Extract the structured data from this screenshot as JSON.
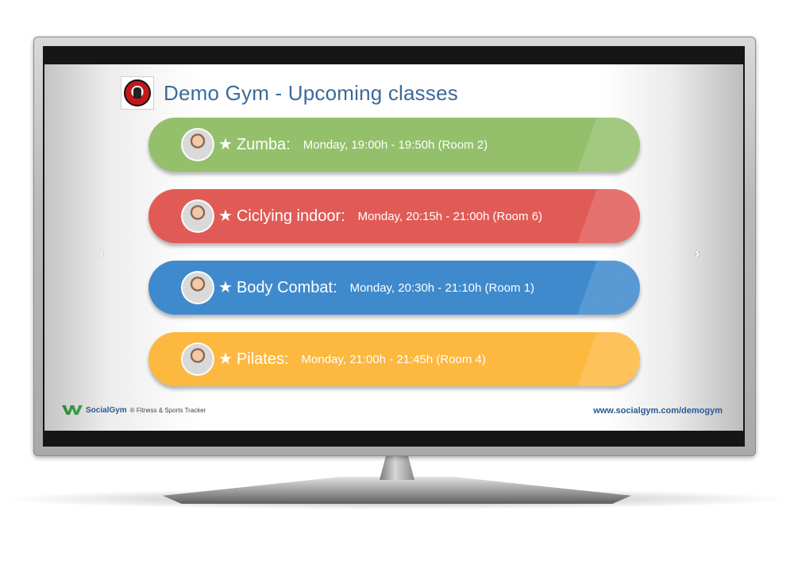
{
  "header": {
    "title": "Demo Gym - Upcoming classes",
    "logo_icon": "gym-mascot-logo-icon"
  },
  "classes": [
    {
      "name": "Zumba:",
      "time": "Monday,  19:00h - 19:50h  (Room 2)",
      "color": "#94c06c"
    },
    {
      "name": "Ciclying indoor:",
      "time": "Monday,  20:15h - 21:00h  (Room 6)",
      "color": "#e15b56"
    },
    {
      "name": "Body Combat:",
      "time": "Monday,  20:30h - 21:10h  (Room 1)",
      "color": "#3f8acd"
    },
    {
      "name": "Pilates:",
      "time": "Monday,  21:00h - 21:45h  (Room 4)",
      "color": "#fdb840"
    }
  ],
  "icons": {
    "star": "★",
    "prev": "‹",
    "next": "›"
  },
  "footer": {
    "brand_name": "SocialGym",
    "brand_tagline": "® Fitness & Sports Tracker",
    "url": "www.socialgym.com/demogym"
  }
}
